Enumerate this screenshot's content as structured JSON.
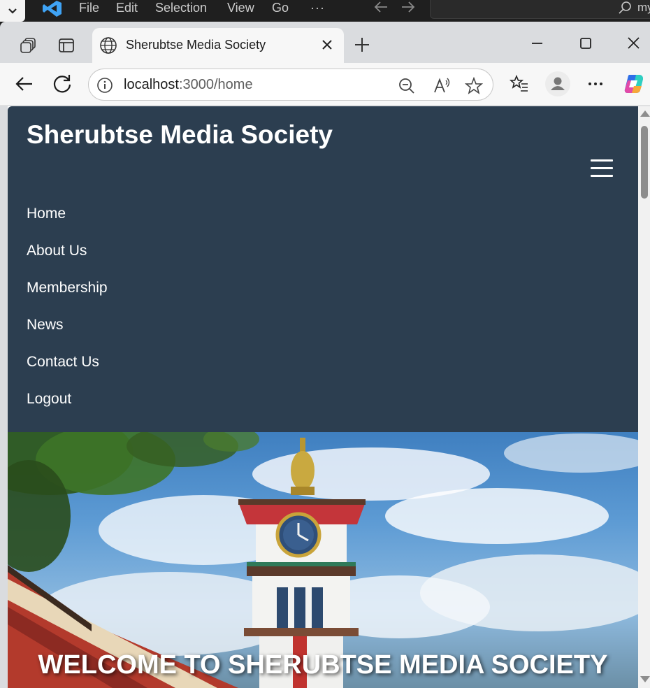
{
  "vscode": {
    "menus": [
      "File",
      "Edit",
      "Selection",
      "View",
      "Go",
      "···"
    ],
    "search_text": "my"
  },
  "browser": {
    "tab_title": "Sherubtse Media Society",
    "url_host": "localhost",
    "url_rest": ":3000/home"
  },
  "site": {
    "title": "Sherubtse Media Society",
    "menu_icon": "☰",
    "nav": [
      "Home",
      "About Us",
      "Membership",
      "News",
      "Contact Us",
      "Logout"
    ],
    "hero_heading": "WELCOME TO SHERUBTSE MEDIA SOCIETY",
    "header_color": "#2c3e50"
  }
}
